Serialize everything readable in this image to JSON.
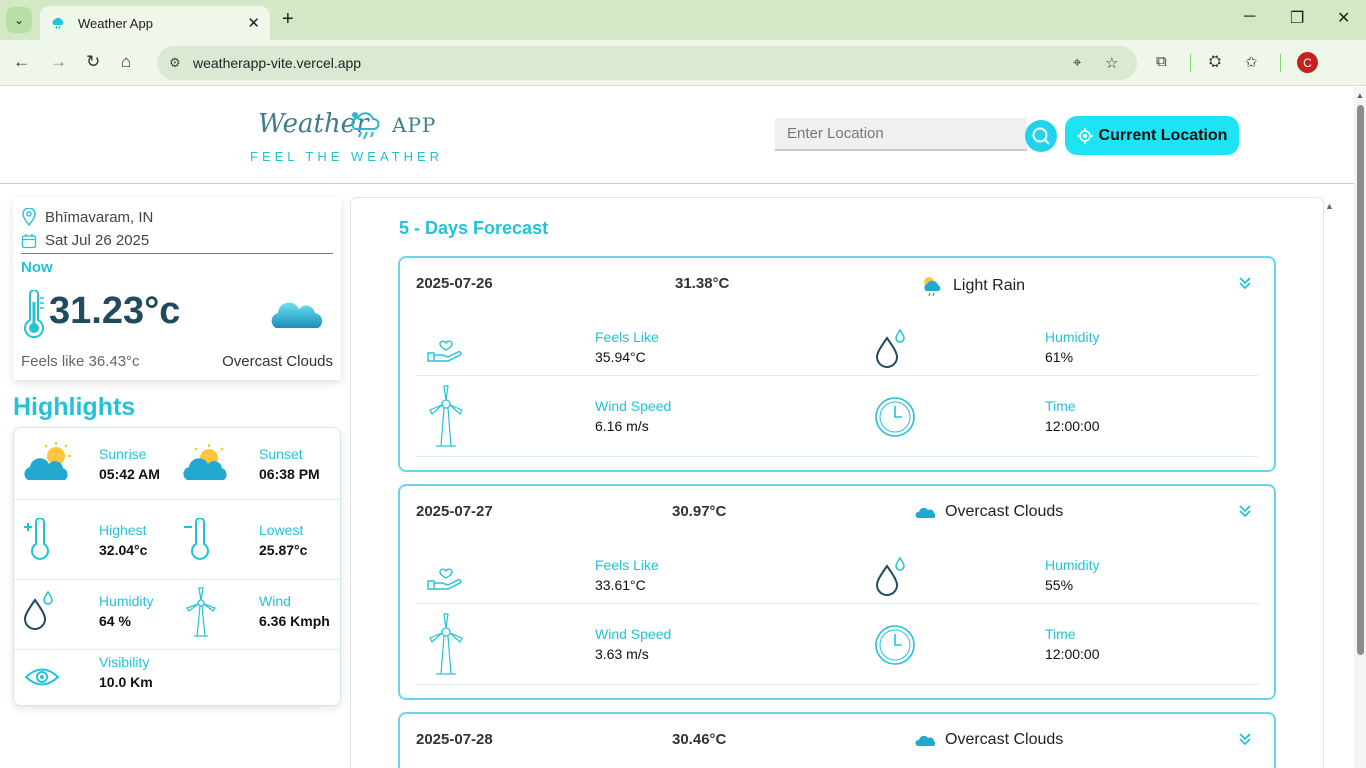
{
  "browser": {
    "tab_title": "Weather App",
    "url": "weatherapp-vite.vercel.app",
    "avatar_letter": "C"
  },
  "header": {
    "logo_word": "Weather",
    "logo_app": "APP",
    "tagline": "FEEL THE WEATHER",
    "search_placeholder": "Enter Location",
    "current_location_label": "Current Location"
  },
  "current": {
    "location": "Bhīmavaram, IN",
    "date": "Sat Jul 26 2025",
    "now_label": "Now",
    "temperature": "31.23°c",
    "feels_like": "Feels like 36.43°c",
    "condition": "Overcast Clouds"
  },
  "highlights": {
    "title": "Highlights",
    "sunrise_label": "Sunrise",
    "sunrise_value": "05:42 AM",
    "sunset_label": "Sunset",
    "sunset_value": "06:38 PM",
    "highest_label": "Highest",
    "highest_value": "32.04°c",
    "lowest_label": "Lowest",
    "lowest_value": "25.87°c",
    "humidity_label": "Humidity",
    "humidity_value": "64 %",
    "wind_label": "Wind",
    "wind_value": "6.36 Kmph",
    "visibility_label": "Visibility",
    "visibility_value": "10.0 Km"
  },
  "forecast": {
    "title": "5 - Days Forecast",
    "days": [
      {
        "date": "2025-07-26",
        "temp": "31.38°C",
        "condition": "Light Rain",
        "feels_label": "Feels Like",
        "feels_value": "35.94°C",
        "humidity_label": "Humidity",
        "humidity_value": "61%",
        "wind_label": "Wind Speed",
        "wind_value": "6.16 m/s",
        "time_label": "Time",
        "time_value": "12:00:00"
      },
      {
        "date": "2025-07-27",
        "temp": "30.97°C",
        "condition": "Overcast Clouds",
        "feels_label": "Feels Like",
        "feels_value": "33.61°C",
        "humidity_label": "Humidity",
        "humidity_value": "55%",
        "wind_label": "Wind Speed",
        "wind_value": "3.63 m/s",
        "time_label": "Time",
        "time_value": "12:00:00"
      },
      {
        "date": "2025-07-28",
        "temp": "30.46°C",
        "condition": "Overcast Clouds"
      }
    ]
  },
  "colors": {
    "accent": "#22c3d8",
    "button": "#1de3f4",
    "temp_text": "#1e4b5e"
  }
}
